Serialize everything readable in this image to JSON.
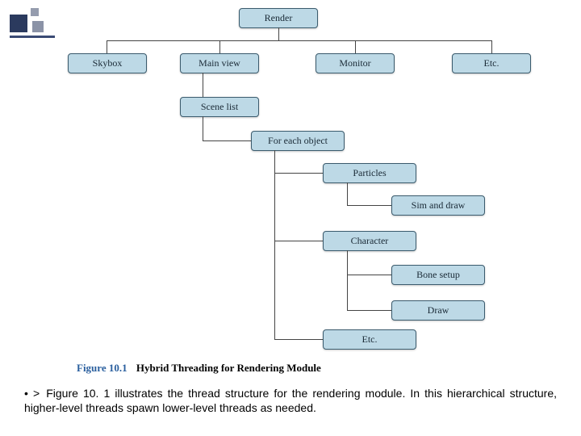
{
  "chart_data": {
    "type": "tree",
    "root": "Render",
    "children": [
      {
        "name": "Skybox"
      },
      {
        "name": "Main view",
        "children": [
          {
            "name": "Scene list",
            "children": [
              {
                "name": "For each object",
                "children": [
                  {
                    "name": "Particles",
                    "children": [
                      {
                        "name": "Sim and draw"
                      }
                    ]
                  },
                  {
                    "name": "Character",
                    "children": [
                      {
                        "name": "Bone setup"
                      },
                      {
                        "name": "Draw"
                      }
                    ]
                  },
                  {
                    "name": "Etc."
                  }
                ]
              }
            ]
          }
        ]
      },
      {
        "name": "Monitor"
      },
      {
        "name": "Etc."
      }
    ]
  },
  "nodes": {
    "render": "Render",
    "skybox": "Skybox",
    "mainview": "Main view",
    "monitor": "Monitor",
    "etc1": "Etc.",
    "scenelist": "Scene list",
    "foreach": "For each object",
    "particles": "Particles",
    "simdraw": "Sim and draw",
    "character": "Character",
    "bonesetup": "Bone setup",
    "draw": "Draw",
    "etc2": "Etc."
  },
  "caption": {
    "fignum": "Figure 10.1",
    "title": "Hybrid Threading for Rendering Module"
  },
  "body": {
    "bullet": "• >",
    "text": "Figure 10. 1 illustrates the thread structure for the rendering module. In this hierarchical structure, higher-level threads spawn lower-level threads as needed."
  }
}
